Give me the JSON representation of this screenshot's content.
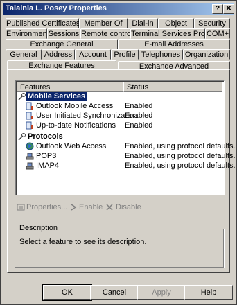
{
  "window": {
    "title": "Talainia L. Posey Properties",
    "help_btn": "?",
    "close_btn": "✕"
  },
  "tabs": {
    "row1": [
      "Published Certificates",
      "Member Of",
      "Dial-in",
      "Object",
      "Security"
    ],
    "row2": [
      "Environment",
      "Sessions",
      "Remote control",
      "Terminal Services Profile",
      "COM+"
    ],
    "row3": [
      "Exchange General",
      "E-mail Addresses"
    ],
    "row4": [
      "General",
      "Address",
      "Account",
      "Profile",
      "Telephones",
      "Organization"
    ],
    "row5": [
      "Exchange Features",
      "Exchange Advanced"
    ]
  },
  "features": {
    "col_features": "Features",
    "col_status": "Status",
    "groups": [
      {
        "label": "Mobile Services",
        "icon": "mobile-services-icon",
        "items": [
          {
            "name": "Outlook Mobile Access",
            "status": "Enabled",
            "icon": "mobile-device-icon"
          },
          {
            "name": "User Initiated Synchronization",
            "status": "Enabled",
            "icon": "mobile-device-icon"
          },
          {
            "name": "Up-to-date Notifications",
            "status": "Enabled",
            "icon": "mobile-device-icon"
          }
        ]
      },
      {
        "label": "Protocols",
        "icon": "protocols-icon",
        "items": [
          {
            "name": "Outlook Web Access",
            "status": "Enabled, using protocol defaults.",
            "icon": "globe-icon"
          },
          {
            "name": "POP3",
            "status": "Enabled, using protocol defaults.",
            "icon": "network-icon"
          },
          {
            "name": "IMAP4",
            "status": "Enabled, using protocol defaults.",
            "icon": "network-icon"
          }
        ]
      }
    ]
  },
  "actions": {
    "properties": "Properties...",
    "enable": "Enable",
    "disable": "Disable"
  },
  "description": {
    "label": "Description",
    "text": "Select a feature to see its description."
  },
  "buttons": {
    "ok": "OK",
    "cancel": "Cancel",
    "apply": "Apply",
    "help": "Help"
  },
  "colors": {
    "title_start": "#0a246a",
    "title_end": "#a6caf0",
    "selection": "#0a246a"
  }
}
